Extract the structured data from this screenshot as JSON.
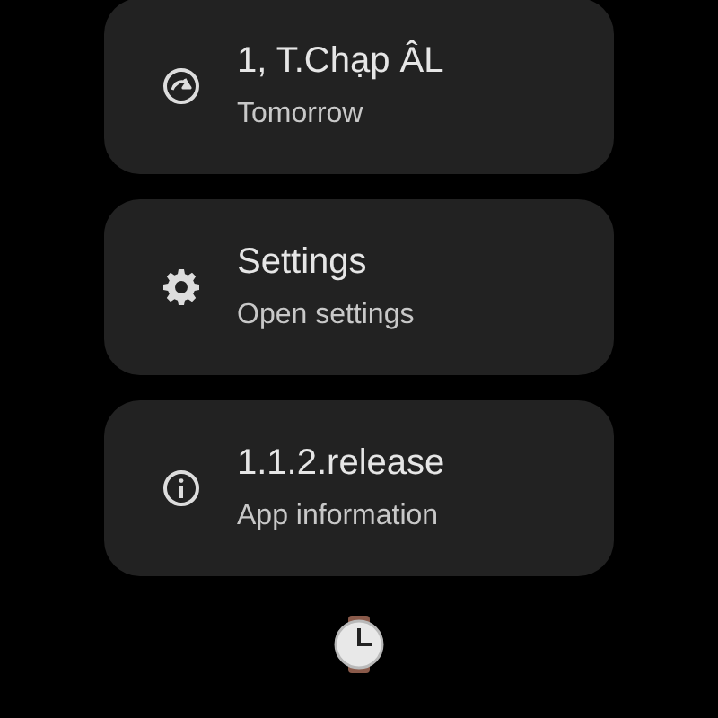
{
  "items": [
    {
      "kind": "refresh",
      "title": "1, T.Chạp ÂL",
      "subtitle": "Tomorrow"
    },
    {
      "kind": "settings",
      "title": "Settings",
      "subtitle": "Open settings"
    },
    {
      "kind": "info",
      "title": "1.1.2.release",
      "subtitle": "App information"
    }
  ]
}
